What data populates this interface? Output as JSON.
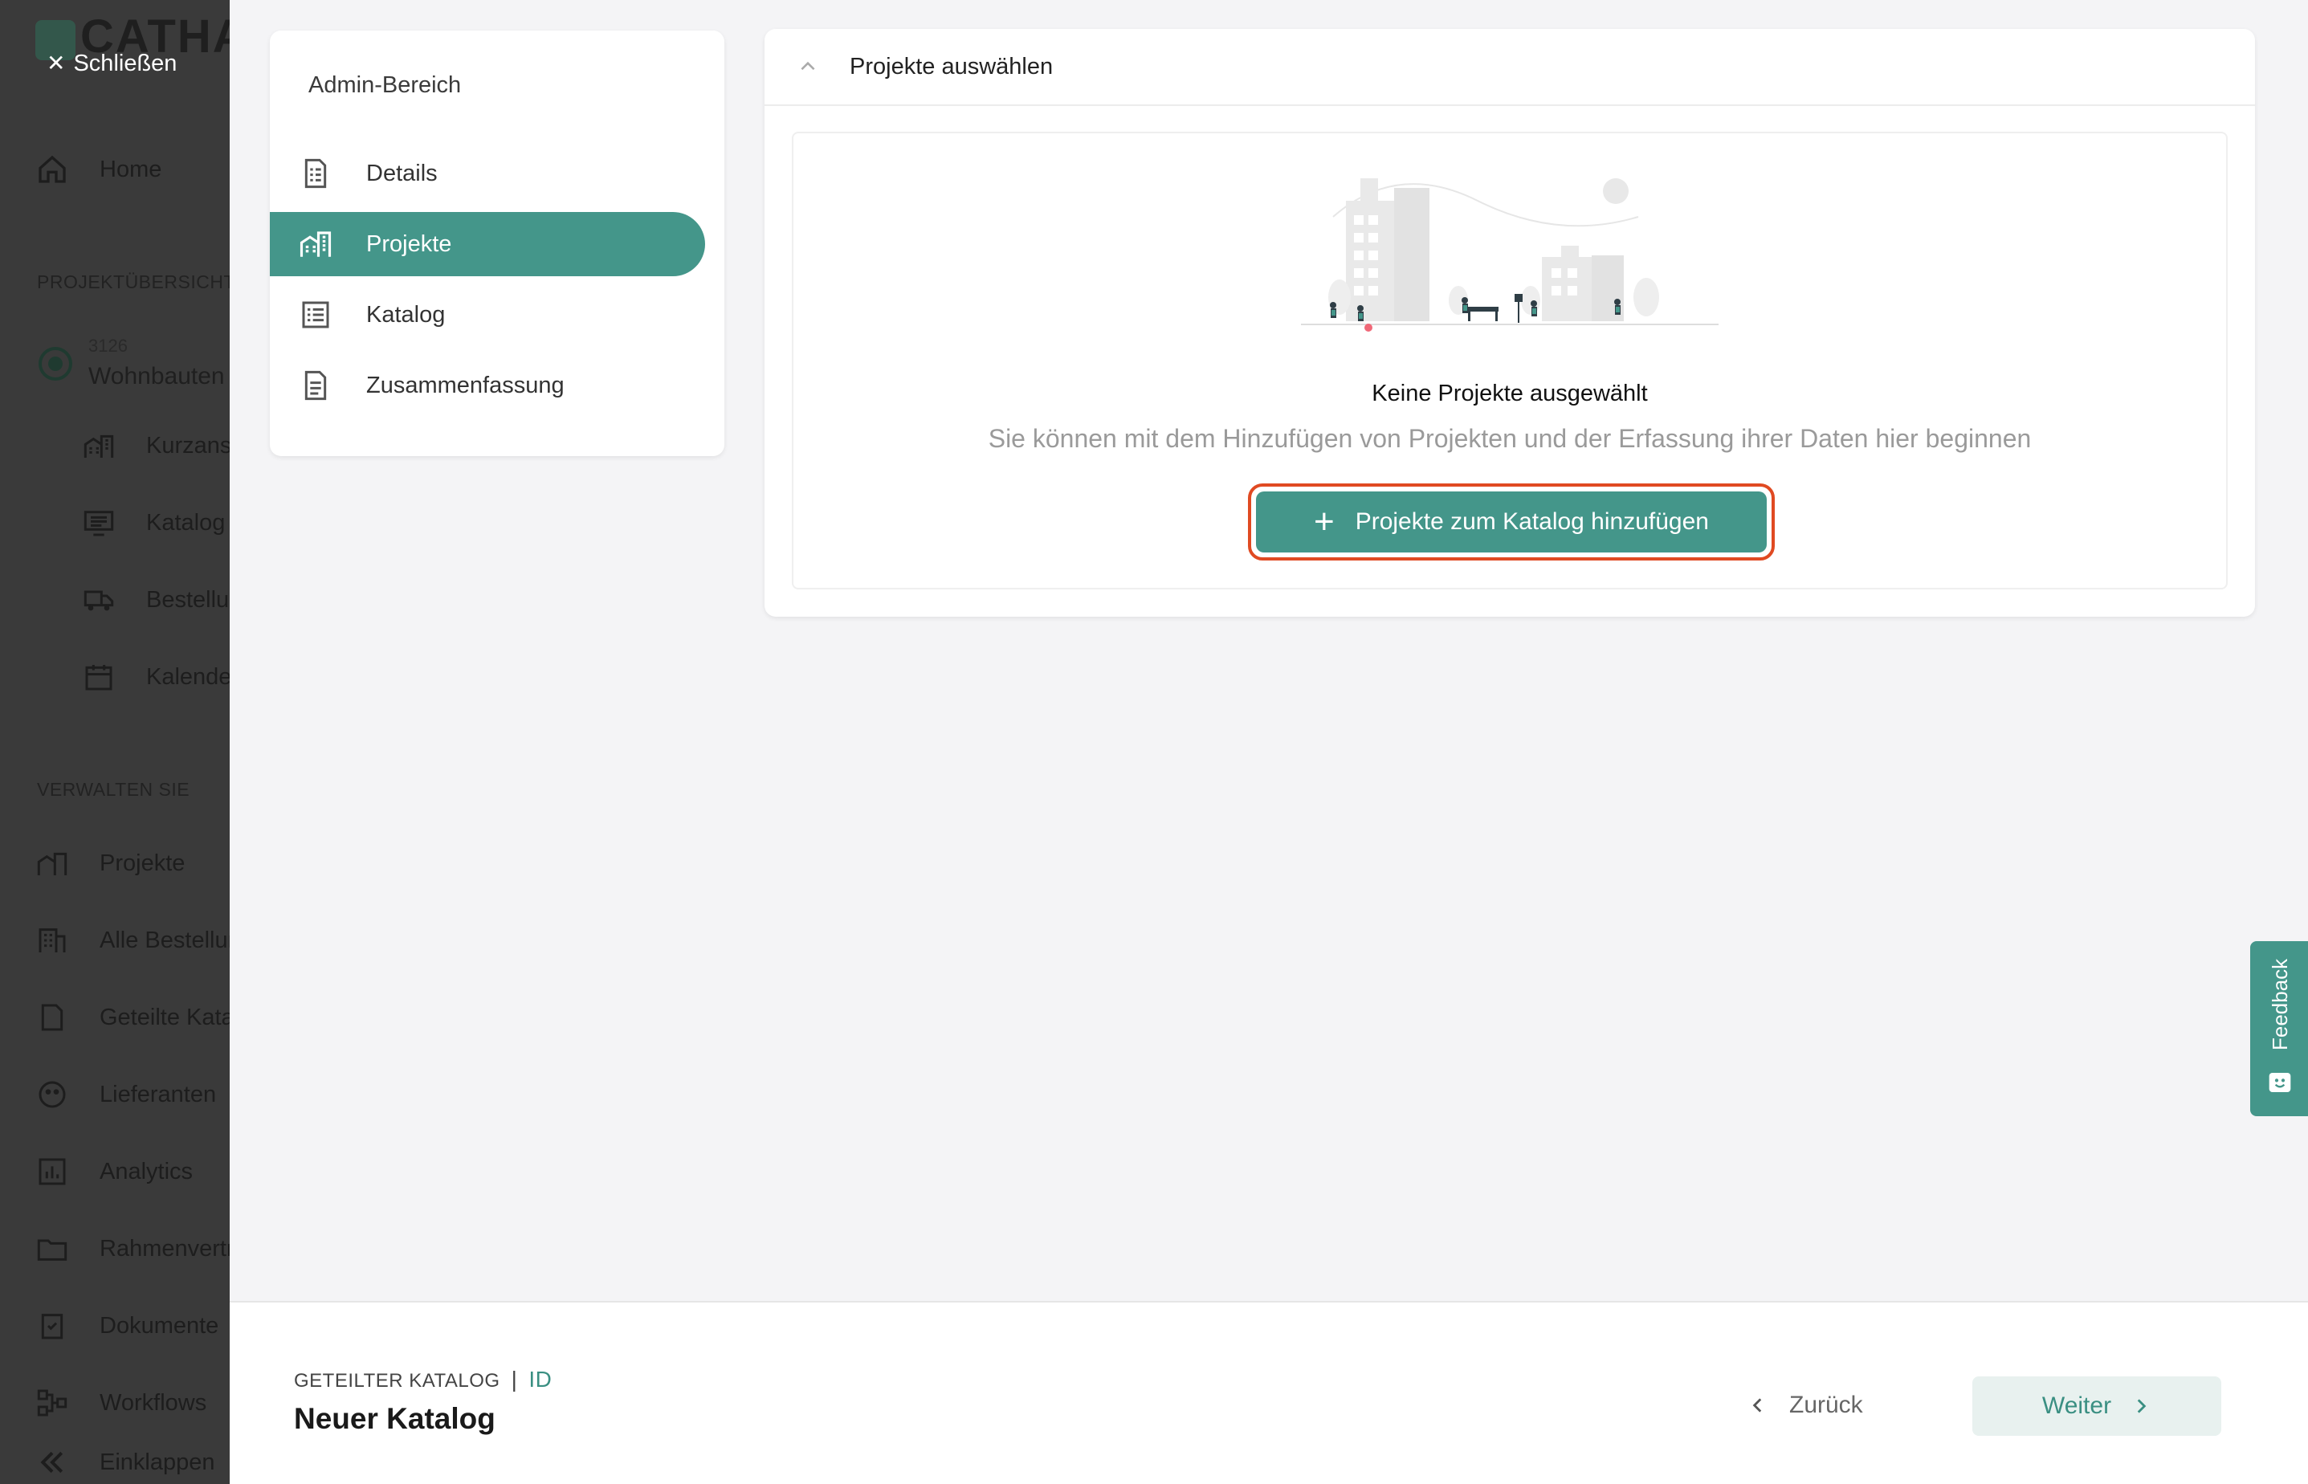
{
  "app_sidebar": {
    "brand": "CATHA",
    "close_label": "Schließen",
    "home_label": "Home",
    "section_projects": "PROJEKTÜBERSICHT",
    "project_number": "3126",
    "project_name": "Wohnbauten",
    "project_items": [
      "Kurzansicht",
      "Katalog",
      "Bestellung",
      "Kalender"
    ],
    "section_manage": "VERWALTEN SIE",
    "manage_items": [
      "Projekte",
      "Alle Bestellungen",
      "Geteilte Kataloge",
      "Lieferanten",
      "Analytics",
      "Rahmenverträge",
      "Dokumente",
      "Workflows"
    ],
    "collapse_label": "Einklappen"
  },
  "admin_nav": {
    "title": "Admin-Bereich",
    "items": [
      {
        "label": "Details",
        "icon": "document-icon",
        "active": false
      },
      {
        "label": "Projekte",
        "icon": "buildings-icon",
        "active": true
      },
      {
        "label": "Katalog",
        "icon": "list-icon",
        "active": false
      },
      {
        "label": "Zusammenfassung",
        "icon": "summary-icon",
        "active": false
      }
    ]
  },
  "panel": {
    "title": "Projekte auswählen",
    "empty_title": "Keine Projekte ausgewählt",
    "empty_subtitle": "Sie können mit dem Hinzufügen von Projekten und der Erfassung ihrer Daten hier beginnen",
    "add_button": "Projekte zum Katalog hinzufügen"
  },
  "feedback": {
    "label": "Feedback"
  },
  "footer": {
    "crumb_label": "GETEILTER KATALOG",
    "crumb_sep": "|",
    "crumb_id": "ID",
    "title": "Neuer Katalog",
    "back_label": "Zurück",
    "next_label": "Weiter"
  },
  "colors": {
    "accent": "#44968a",
    "highlight": "#e04a22",
    "sidebar_bg": "#3a3a3a"
  }
}
